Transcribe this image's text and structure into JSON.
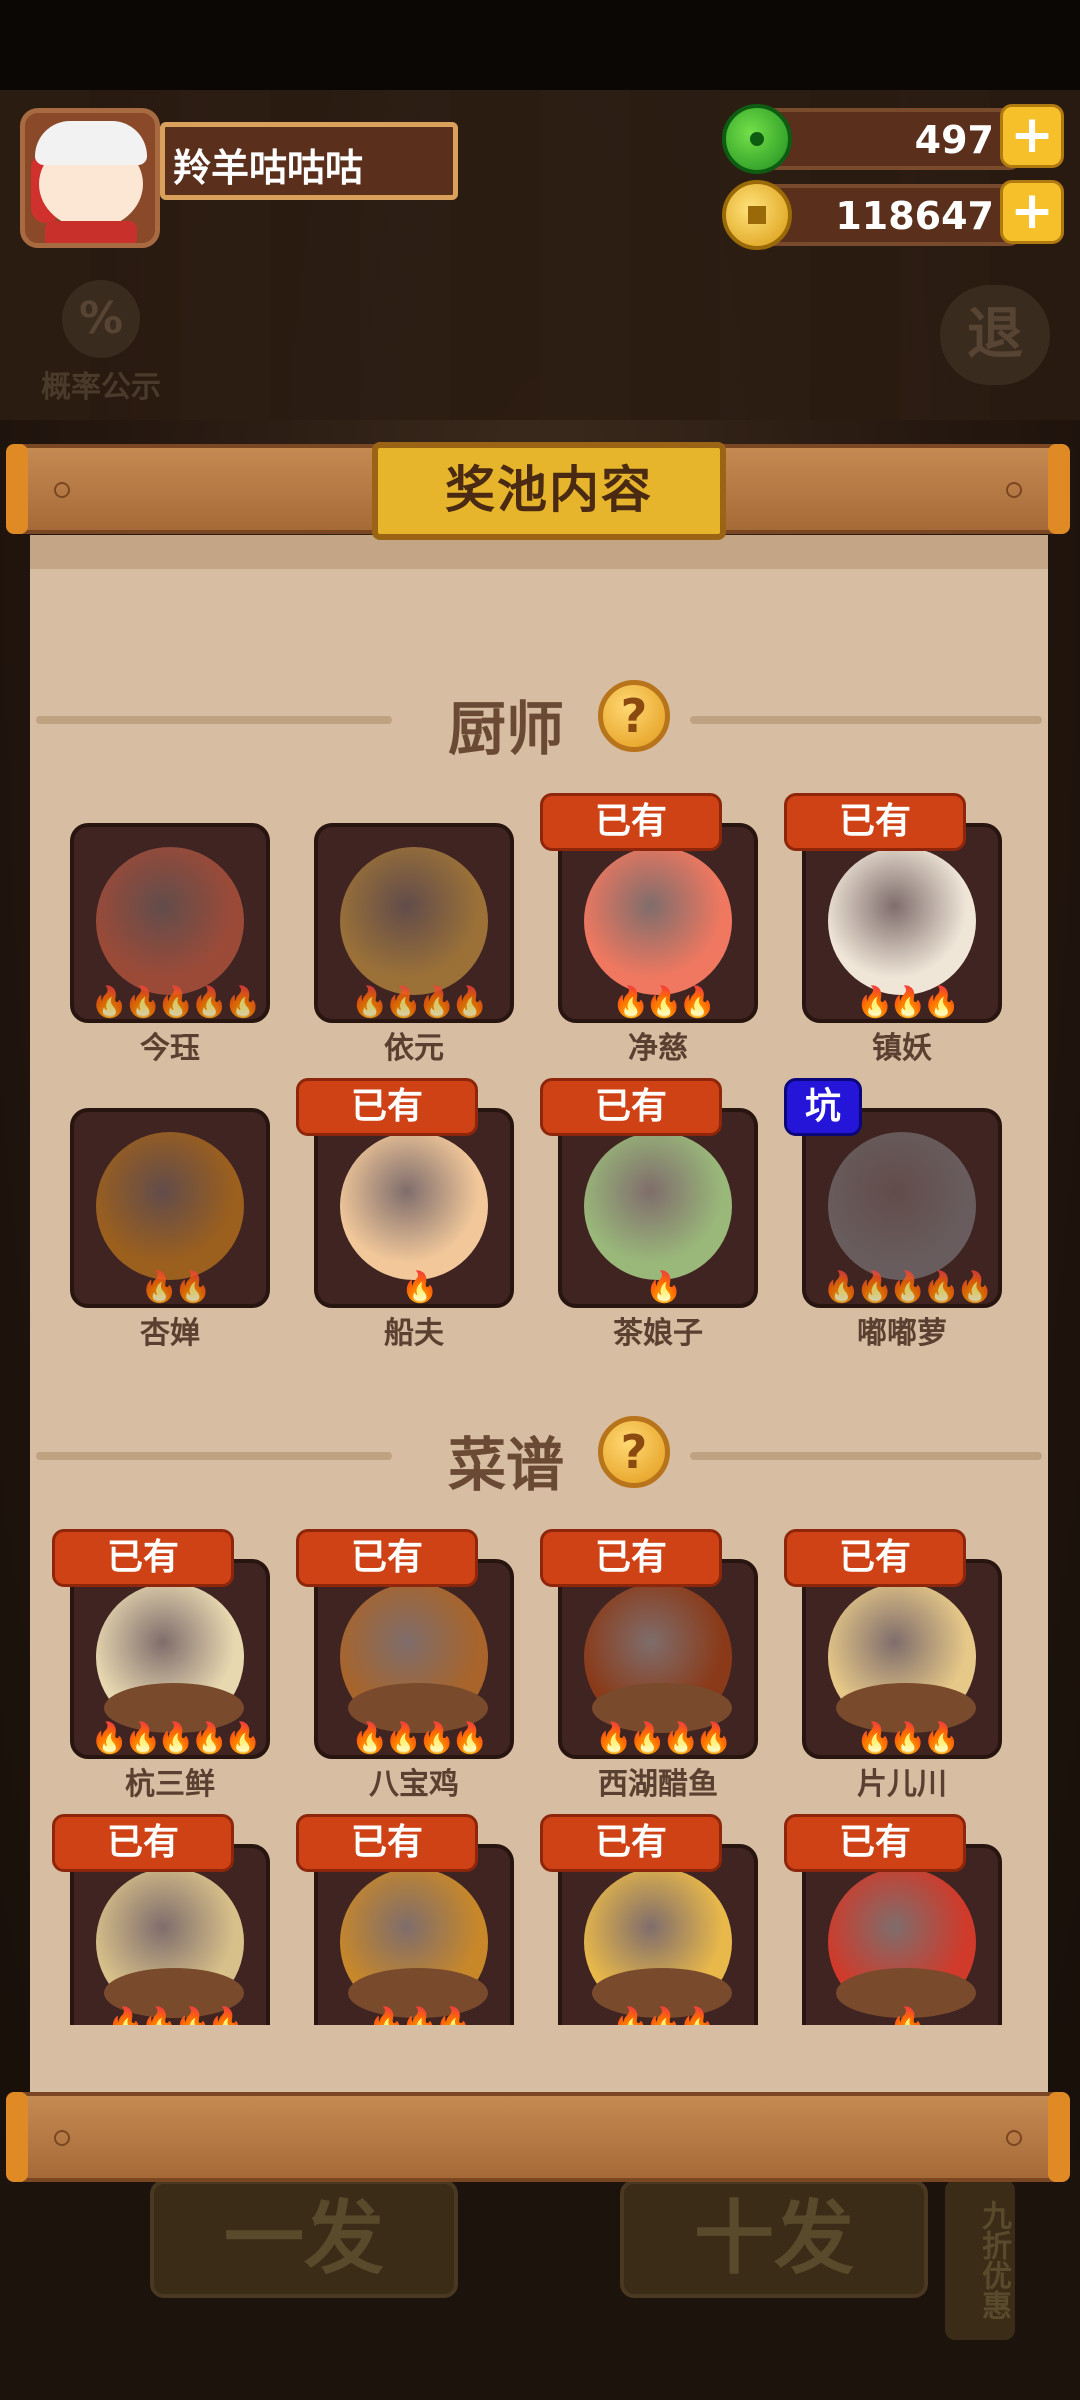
{
  "user": {
    "name": "羚羊咕咕咕"
  },
  "resources": {
    "jade": "497",
    "coins": "118647",
    "plus": "+"
  },
  "background": {
    "rate_label": "概率公示",
    "rate_symbol": "%",
    "exit_label": "退",
    "single_draw": "一发",
    "ten_draw": "十发",
    "discount": "九折优惠"
  },
  "panel": {
    "title": "奖池内容"
  },
  "chef_section": {
    "title": "厨师",
    "help": "?",
    "items": [
      {
        "name": "今珏",
        "flames": "🔥🔥🔥🔥🔥",
        "badge": "",
        "art": "#e86a4a"
      },
      {
        "name": "依元",
        "flames": "🔥🔥🔥🔥",
        "badge": "",
        "art": "#e6b04a"
      },
      {
        "name": "净慈",
        "flames": "🔥🔥🔥",
        "badge": "已有",
        "art": "#f07860"
      },
      {
        "name": "镇妖",
        "flames": "🔥🔥🔥",
        "badge": "已有",
        "art": "#f0e6d8"
      },
      {
        "name": "杏婵",
        "flames": "🔥🔥",
        "badge": "",
        "art": "#e8901a"
      },
      {
        "name": "船夫",
        "flames": "🔥",
        "badge": "已有",
        "art": "#f2c89a"
      },
      {
        "name": "茶娘子",
        "flames": "🔥",
        "badge": "已有",
        "art": "#9ab87a"
      },
      {
        "name": "嘟嘟萝",
        "flames": "🔥🔥🔥🔥🔥",
        "badge": "坑",
        "art": "#8a8a8e"
      }
    ]
  },
  "recipe_section": {
    "title": "菜谱",
    "help": "?",
    "items": [
      {
        "name": "杭三鲜",
        "flames": "🔥🔥🔥🔥🔥",
        "badge": "已有",
        "art": "#e8d8b0"
      },
      {
        "name": "八宝鸡",
        "flames": "🔥🔥🔥🔥",
        "badge": "已有",
        "art": "#a8642a"
      },
      {
        "name": "西湖醋鱼",
        "flames": "🔥🔥🔥🔥",
        "badge": "已有",
        "art": "#8a3a18"
      },
      {
        "name": "片儿川",
        "flames": "🔥🔥🔥",
        "badge": "已有",
        "art": "#e6c888"
      },
      {
        "name": "",
        "flames": "🔥🔥🔥🔥",
        "badge": "已有",
        "art": "#d8c08a"
      },
      {
        "name": "",
        "flames": "🔥🔥🔥",
        "badge": "已有",
        "art": "#c8882a"
      },
      {
        "name": "",
        "flames": "🔥🔥🔥",
        "badge": "已有",
        "art": "#e8b84a"
      },
      {
        "name": "",
        "flames": "🔥",
        "badge": "已有",
        "art": "#d03a2a"
      }
    ]
  }
}
